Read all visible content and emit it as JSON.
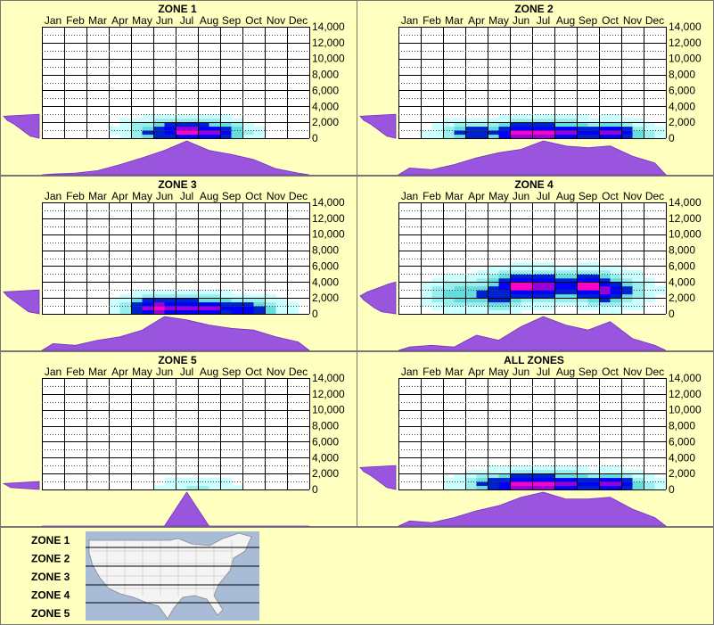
{
  "months": [
    "Jan",
    "Feb",
    "Mar",
    "Apr",
    "May",
    "Jun",
    "Jul",
    "Aug",
    "Sep",
    "Oct",
    "Nov",
    "Dec"
  ],
  "y_ticks": [
    "14,000",
    "12,000",
    "10,000",
    "8,000",
    "6,000",
    "4,000",
    "2,000",
    "0"
  ],
  "legend_labels": [
    "ZONE 1",
    "ZONE 2",
    "ZONE 3",
    "ZONE 4",
    "ZONE 5"
  ],
  "colors": {
    "background": "#ffffc0",
    "profile_fill": "#9955dd",
    "heat_low": "#ccffff",
    "heat_mid": "#66dddd",
    "heat_blue": "#0000ff",
    "heat_high": "#ff00cc",
    "map_water": "#a8bcd8",
    "map_land": "#f4f4f4"
  },
  "chart_data": [
    {
      "type": "heatmap",
      "title": "ZONE 1",
      "x_categories": [
        "Jan",
        "Feb",
        "Mar",
        "Apr",
        "May",
        "Jun",
        "Jul",
        "Aug",
        "Sep",
        "Oct",
        "Nov",
        "Dec"
      ],
      "ylim": [
        0,
        14000
      ],
      "monthly_profile": [
        0.02,
        0.05,
        0.12,
        0.3,
        0.5,
        0.72,
        1.0,
        0.72,
        0.6,
        0.45,
        0.18,
        0.05
      ],
      "elevation_profile": [
        0.25,
        0.4,
        0.55,
        0.7,
        0.9,
        1.0
      ],
      "hotspots": [
        {
          "month": 6.5,
          "elev": 900,
          "v": 1.0
        },
        {
          "month": 7.5,
          "elev": 700,
          "v": 0.9
        },
        {
          "month": 5.5,
          "elev": 900,
          "v": 0.7
        }
      ]
    },
    {
      "type": "heatmap",
      "title": "ZONE 2",
      "x_categories": [
        "Jan",
        "Feb",
        "Mar",
        "Apr",
        "May",
        "Jun",
        "Jul",
        "Aug",
        "Sep",
        "Oct",
        "Nov",
        "Dec"
      ],
      "ylim": [
        0,
        14000
      ],
      "monthly_profile": [
        0.2,
        0.15,
        0.3,
        0.5,
        0.65,
        0.75,
        1.0,
        0.85,
        0.8,
        0.85,
        0.55,
        0.35
      ],
      "elevation_profile": [
        0.25,
        0.4,
        0.55,
        0.7,
        0.9,
        1.0
      ],
      "hotspots": [
        {
          "month": 5.5,
          "elev": 700,
          "v": 1.0
        },
        {
          "month": 6.5,
          "elev": 700,
          "v": 1.0
        },
        {
          "month": 7.5,
          "elev": 700,
          "v": 0.95
        },
        {
          "month": 9.5,
          "elev": 600,
          "v": 0.9
        },
        {
          "month": 3.5,
          "elev": 600,
          "v": 0.7
        }
      ]
    },
    {
      "type": "heatmap",
      "title": "ZONE 3",
      "x_categories": [
        "Jan",
        "Feb",
        "Mar",
        "Apr",
        "May",
        "Jun",
        "Jul",
        "Aug",
        "Sep",
        "Oct",
        "Nov",
        "Dec"
      ],
      "ylim": [
        0,
        14000
      ],
      "monthly_profile": [
        0.2,
        0.15,
        0.3,
        0.4,
        0.6,
        1.0,
        0.9,
        0.75,
        0.65,
        0.6,
        0.4,
        0.25
      ],
      "elevation_profile": [
        0.3,
        0.45,
        0.6,
        0.75,
        0.9,
        1.0
      ],
      "hotspots": [
        {
          "month": 5.3,
          "elev": 800,
          "v": 1.0
        },
        {
          "month": 6.5,
          "elev": 800,
          "v": 0.95
        },
        {
          "month": 7.5,
          "elev": 700,
          "v": 0.9
        },
        {
          "month": 9.0,
          "elev": 600,
          "v": 0.8
        }
      ]
    },
    {
      "type": "heatmap",
      "title": "ZONE 4",
      "x_categories": [
        "Jan",
        "Feb",
        "Mar",
        "Apr",
        "May",
        "Jun",
        "Jul",
        "Aug",
        "Sep",
        "Oct",
        "Nov",
        "Dec"
      ],
      "ylim": [
        0,
        14000
      ],
      "monthly_profile": [
        0.1,
        0.15,
        0.1,
        0.45,
        0.3,
        0.7,
        1.0,
        0.75,
        0.6,
        0.85,
        0.35,
        0.15
      ],
      "elevation_profile": [
        0.4,
        0.6,
        0.75,
        0.9,
        1.0,
        0.8,
        0.5,
        0.2
      ],
      "hotspots": [
        {
          "month": 5.5,
          "elev": 3500,
          "v": 1.0
        },
        {
          "month": 6.5,
          "elev": 3500,
          "v": 0.95
        },
        {
          "month": 8.5,
          "elev": 3500,
          "v": 1.0
        },
        {
          "month": 9.3,
          "elev": 3000,
          "v": 0.9
        },
        {
          "month": 4.5,
          "elev": 2500,
          "v": 0.7
        },
        {
          "month": 3.0,
          "elev": 2500,
          "v": 0.55
        }
      ]
    },
    {
      "type": "heatmap",
      "title": "ZONE 5",
      "x_categories": [
        "Jan",
        "Feb",
        "Mar",
        "Apr",
        "May",
        "Jun",
        "Jul",
        "Aug",
        "Sep",
        "Oct",
        "Nov",
        "Dec"
      ],
      "ylim": [
        0,
        14000
      ],
      "monthly_profile": [
        0,
        0,
        0,
        0,
        0,
        0,
        1.0,
        0,
        0,
        0,
        0,
        0
      ],
      "elevation_profile": [
        0.8,
        1.0
      ],
      "hotspots": [
        {
          "month": 7.0,
          "elev": 100,
          "v": 0.3
        }
      ]
    },
    {
      "type": "heatmap",
      "title": "ALL ZONES",
      "x_categories": [
        "Jan",
        "Feb",
        "Mar",
        "Apr",
        "May",
        "Jun",
        "Jul",
        "Aug",
        "Sep",
        "Oct",
        "Nov",
        "Dec"
      ],
      "ylim": [
        0,
        14000
      ],
      "monthly_profile": [
        0.15,
        0.1,
        0.25,
        0.45,
        0.6,
        0.85,
        1.0,
        0.8,
        0.8,
        0.85,
        0.5,
        0.25
      ],
      "elevation_profile": [
        0.25,
        0.4,
        0.55,
        0.7,
        0.9,
        1.0
      ],
      "hotspots": [
        {
          "month": 5.5,
          "elev": 700,
          "v": 1.0
        },
        {
          "month": 6.5,
          "elev": 700,
          "v": 1.0
        },
        {
          "month": 7.5,
          "elev": 700,
          "v": 0.9
        },
        {
          "month": 9.5,
          "elev": 600,
          "v": 0.9
        },
        {
          "month": 4.5,
          "elev": 700,
          "v": 0.7
        }
      ]
    }
  ]
}
